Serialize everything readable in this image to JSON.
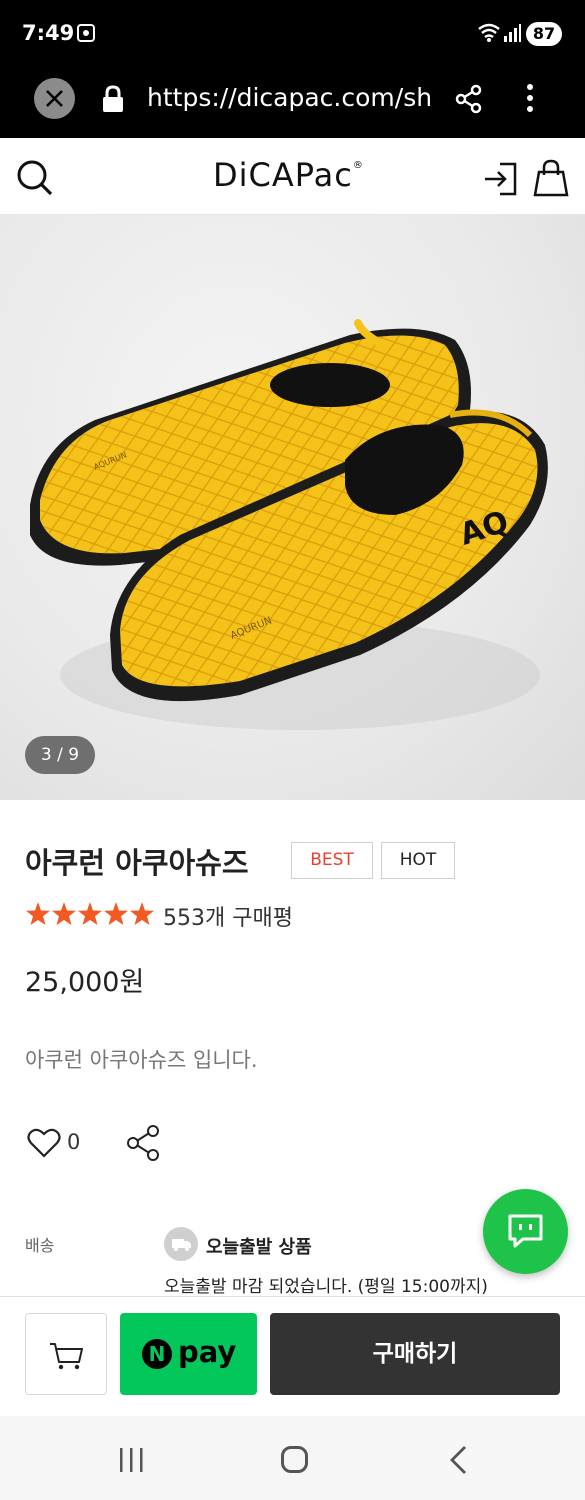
{
  "status_bar": {
    "time": "7:49",
    "battery": "87"
  },
  "browser": {
    "url": "https://dicapac.com/sh"
  },
  "site": {
    "logo": "DiCAPac",
    "logo_mark": "®"
  },
  "gallery": {
    "counter": "3 / 9",
    "shoe_brand_text": "AQURUN",
    "shoe_logo_text": "AQ"
  },
  "product": {
    "title": "아쿠런 아쿠아슈즈",
    "tags": [
      "BEST",
      "HOT"
    ],
    "rating": 5,
    "review_count": "553개 구매평",
    "price": "25,000원",
    "description": "아쿠런 아쿠아슈즈 입니다.",
    "likes": "0"
  },
  "shipping": {
    "label": "배송",
    "badge": "오늘출발 상품",
    "note": "오늘출발 마감 되었습니다. (평일 15:00까지)"
  },
  "buy_bar": {
    "npay_n": "N",
    "npay_label": "pay",
    "buy_label": "구매하기"
  },
  "colors": {
    "accent_red": "#e8402f",
    "npay_green": "#03c75a",
    "chat_green": "#1fc34a",
    "star": "#f15a24",
    "shoe_yellow": "#f5c21a"
  }
}
